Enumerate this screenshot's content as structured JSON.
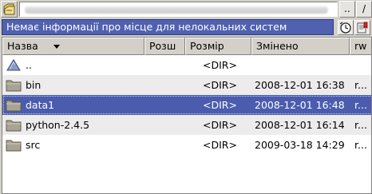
{
  "toolbar": {
    "path_value": "",
    "up_label": "..",
    "root_label": "/"
  },
  "status": {
    "text": "Немає інформації про місце для нелокальних систем"
  },
  "columns": {
    "name": "Назва",
    "ext": "Розш",
    "size": "Розмір",
    "modified": "Змінено",
    "attrs": "rw"
  },
  "rows": [
    {
      "name": "..",
      "size": "<DIR>",
      "modified": "",
      "attrs": "",
      "icon": "up-arrow-icon"
    },
    {
      "name": "bin",
      "size": "<DIR>",
      "modified": "2008-12-01 16:38",
      "attrs": "r...",
      "icon": "folder-icon"
    },
    {
      "name": "data1",
      "size": "<DIR>",
      "modified": "2008-12-01 16:48",
      "attrs": "r...",
      "icon": "folder-icon",
      "selected": true
    },
    {
      "name": "python-2.4.5",
      "size": "<DIR>",
      "modified": "2008-12-01 16:14",
      "attrs": "r...",
      "icon": "folder-icon"
    },
    {
      "name": "src",
      "size": "<DIR>",
      "modified": "2009-03-18 14:29",
      "attrs": "r...",
      "icon": "folder-icon"
    }
  ],
  "colors": {
    "status_bg": "#5061b0",
    "selection_bg": "#4b5cae",
    "folder": "#a8a493"
  }
}
